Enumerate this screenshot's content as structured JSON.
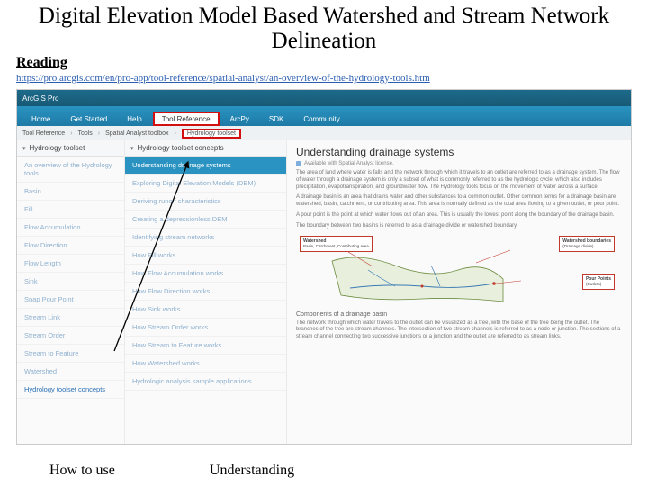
{
  "title": "Digital Elevation Model Based Watershed and Stream Network Delineation",
  "reading_label": "Reading",
  "url": "https://pro.arcgis.com/en/pro-app/tool-reference/spatial-analyst/an-overview-of-the-hydrology-tools.htm",
  "topbar": {
    "brand": "ArcGIS Pro"
  },
  "nav": {
    "tabs": [
      "Home",
      "Get Started",
      "Help",
      "Tool Reference",
      "ArcPy",
      "SDK",
      "Community"
    ],
    "highlighted_index": 3
  },
  "breadcrumb": {
    "items": [
      "Tool Reference",
      "Tools",
      "Spatial Analyst toolbox",
      "Hydrology toolset"
    ],
    "highlighted_index": 3
  },
  "col1": {
    "header": "Hydrology toolset",
    "items": [
      "An overview of the Hydrology tools",
      "Basin",
      "Fill",
      "Flow Accumulation",
      "Flow Direction",
      "Flow Length",
      "Sink",
      "Snap Pour Point",
      "Stream Link",
      "Stream Order",
      "Stream to Feature",
      "Watershed",
      "Hydrology toolset concepts"
    ]
  },
  "col2": {
    "header": "Hydrology toolset concepts",
    "items": [
      "Understanding drainage systems",
      "Exploring Digital Elevation Models (DEM)",
      "Deriving runoff characteristics",
      "Creating a depressionless DEM",
      "Identifying stream networks",
      "How Fill works",
      "How Flow Accumulation works",
      "How Flow Direction works",
      "How Sink works",
      "How Stream Order works",
      "How Stream to Feature works",
      "How Watershed works",
      "Hydrologic analysis sample applications"
    ],
    "active_index": 0
  },
  "article": {
    "heading": "Understanding drainage systems",
    "license": "Available with Spatial Analyst license.",
    "p1": "The area of land where water is falls and the network through which it travels to an outlet are referred to as a drainage system. The flow of water through a drainage system is only a subset of what is commonly referred to as the hydrologic cycle, which also includes precipitation, evapotranspiration, and groundwater flow. The Hydrology tools focus on the movement of water across a surface.",
    "p2": "A drainage basin is an area that drains water and other substances to a common outlet. Other common terms for a drainage basin are watershed, basin, catchment, or contributing area. This area is normally defined as the total area flowing to a given outlet, or pour point.",
    "p3": "A pour point is the point at which water flows out of an area. This is usually the lowest point along the boundary of the drainage basin.",
    "p4": "The boundary between two basins is referred to as a drainage divide or watershed boundary.",
    "diagram": {
      "watershed_label": "Watershed",
      "watershed_sub": "Basin, Catchment, Contributing Area",
      "boundary_label": "Watershed boundaries",
      "boundary_sub": "(Drainage divide)",
      "pour_label": "Pour Points",
      "pour_sub": "(Outlets)"
    },
    "subhead": "Components of a drainage basin",
    "p5": "The network through which water travels to the outlet can be visualized as a tree, with the base of the tree being the outlet. The branches of the tree are stream channels. The intersection of two stream channels is referred to as a node or junction. The sections of a stream channel connecting two successive junctions or a junction and the outlet are referred to as stream links."
  },
  "bottom": {
    "how_to": "How to use",
    "under": "Understanding"
  }
}
